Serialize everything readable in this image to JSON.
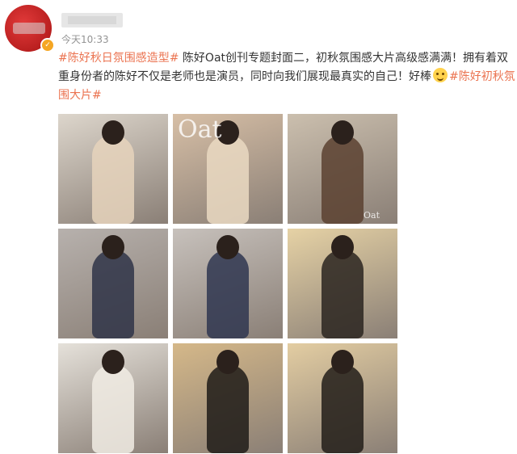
{
  "post": {
    "timestamp": "今天10:33",
    "text_segments": [
      {
        "text": "#陈好秋日氛围感造型#",
        "topic": true
      },
      {
        "text": " 陈好Oat创刊专题封面二，初秋氛围感大片高级感满满！拥有着双重身份者的陈好不仅是老师也是演员，同时向我们展现最真实的自己！好棒",
        "topic": false
      },
      {
        "text": "#陈好初秋氛围大片#",
        "topic": true
      }
    ],
    "emoji_name": "laughing-tears-icon",
    "photos": [
      {
        "bg": "#ddd6cc",
        "fig": "#e6d3bc"
      },
      {
        "bg": "#d7bfa6",
        "fig": "#ead9c2",
        "watermark": "Oat"
      },
      {
        "bg": "#cbbfae",
        "fig": "#5a4130",
        "watermark": "Oat"
      },
      {
        "bg": "#b7b1ad",
        "fig": "#2f3448"
      },
      {
        "bg": "#c7c1bc",
        "fig": "#2f3650"
      },
      {
        "bg": "#e6d2a5",
        "fig": "#2a2520"
      },
      {
        "bg": "#e5e1da",
        "fig": "#f1ece4"
      },
      {
        "bg": "#d5b889",
        "fig": "#1f1b18"
      },
      {
        "bg": "#e3cda2",
        "fig": "#221d19"
      }
    ]
  },
  "colors": {
    "topic": "#eb7350",
    "text": "#333333",
    "meta": "#939393"
  }
}
